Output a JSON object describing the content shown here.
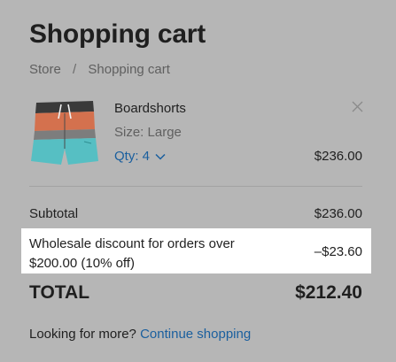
{
  "page": {
    "title": "Shopping cart"
  },
  "breadcrumb": {
    "items": [
      "Store",
      "Shopping cart"
    ],
    "separator": "/"
  },
  "cart_item": {
    "name": "Boardshorts",
    "size": "Size: Large",
    "qty": "Qty: 4",
    "price": "$236.00",
    "image_icon": "boardshorts-image",
    "remove_icon": "close-icon"
  },
  "summary": {
    "subtotal_label": "Subtotal",
    "subtotal_value": "$236.00",
    "discount_label": "Wholesale discount for orders over $200.00 (10% off)",
    "discount_value": "–$23.60",
    "total_label": "TOTAL",
    "total_value": "$212.40"
  },
  "footer": {
    "prompt": "Looking for more?",
    "link": "Continue shopping"
  },
  "colors": {
    "background": "#b6b6b6",
    "link": "#1a5f9e",
    "highlight": "#ffffff"
  }
}
